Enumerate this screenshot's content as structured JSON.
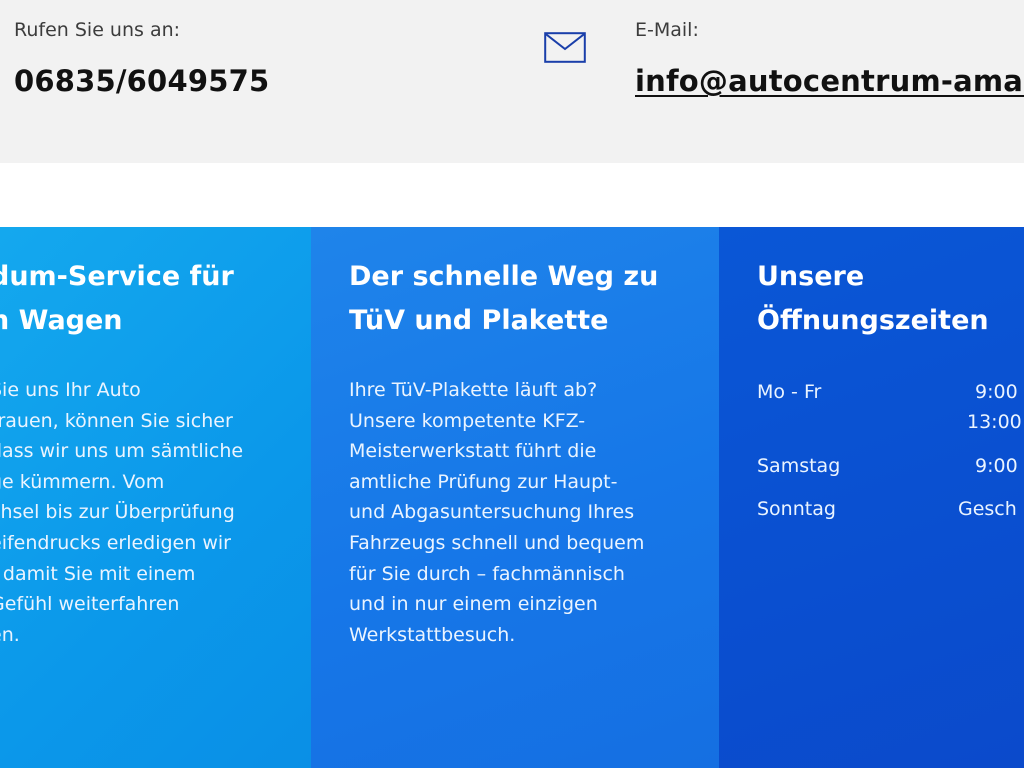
{
  "contact": {
    "phone_label": "Rufen Sie uns an:",
    "phone_value": "06835/6049575",
    "mail_icon": "envelope-icon",
    "mail_label": "E-Mail:",
    "mail_value": "info@autocentrum-amar"
  },
  "columns": [
    {
      "title_lines": [
        "dum-Service für",
        "n Wagen"
      ],
      "text_lines": [
        " Sie uns Ihr Auto",
        "trauen, können Sie sicher",
        "dass wir uns um sämtliche",
        "ge kümmern. Vom",
        "chsel bis zur Überprüfung",
        "eifendrucks erledigen wir",
        "- damit Sie mit einem",
        " Gefühl weiterfahren",
        "en."
      ]
    },
    {
      "title_lines": [
        "Der schnelle Weg zu",
        "TüV und Plakette"
      ],
      "text_lines": [
        "Ihre TüV-Plakette läuft ab?",
        "Unsere kompetente KFZ-",
        "Meisterwerkstatt führt die",
        "amtliche Prüfung zur Haupt-",
        "und Abgasuntersuchung Ihres",
        "Fahrzeugs schnell und bequem",
        "für Sie durch – fachmännisch",
        "und in nur einem einzigen",
        "Werkstattbesuch."
      ]
    },
    {
      "title_lines": [
        "Unsere",
        "Öffnungszeiten"
      ],
      "hours": [
        {
          "day": "Mo - Fr",
          "times": [
            "9:00",
            "13:00 -"
          ]
        },
        {
          "day": "Samstag",
          "times": [
            "9:00"
          ]
        },
        {
          "day": "Sonntag",
          "times": [
            "Gesch"
          ]
        }
      ]
    }
  ],
  "colors": {
    "contact_bg": "#f2f2f2",
    "col1": "#0b98ea",
    "col2": "#1677e8",
    "col3": "#0a4fd0",
    "icon_stroke": "#1a3faa"
  }
}
